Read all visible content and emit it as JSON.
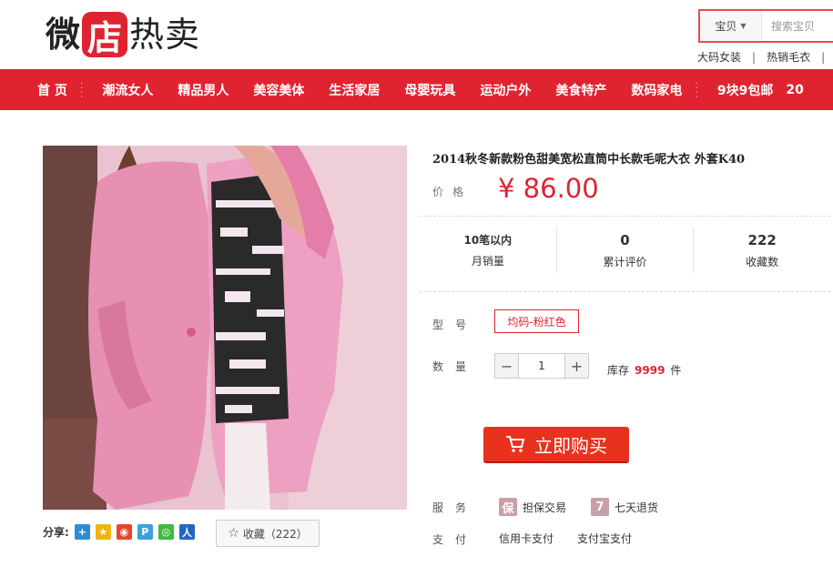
{
  "logo": {
    "char1": "微",
    "char2": "店",
    "rest": "热卖"
  },
  "search": {
    "type_label": "宝贝",
    "placeholder": "搜索宝贝"
  },
  "hot_links": [
    "大码女装",
    "热销毛衣"
  ],
  "nav": {
    "home": "首 页",
    "items": [
      "潮流女人",
      "精品男人",
      "美容美体",
      "生活家居",
      "母婴玩具",
      "运动户外",
      "美食特产",
      "数码家电",
      "9块9包邮",
      "20"
    ]
  },
  "product": {
    "title": "2014秋冬新款粉色甜美宽松直筒中长款毛呢大衣 外套K40",
    "price_label": "价格",
    "price": "¥ 86.00",
    "stats": [
      {
        "value": "10笔以内",
        "label": "月销量"
      },
      {
        "value": "0",
        "label": "累计评价"
      },
      {
        "value": "222",
        "label": "收藏数"
      }
    ],
    "model_label": "型号",
    "model_option": "均码-粉红色",
    "qty_label": "数量",
    "qty_value": "1",
    "stock_prefix": "库存",
    "stock_num": "9999",
    "stock_unit": "件",
    "buy_label": "立即购买",
    "service_label": "服务",
    "services": [
      {
        "icon": "保",
        "text": "担保交易"
      },
      {
        "icon": "7",
        "text": "七天退货"
      }
    ],
    "payment_label": "支付",
    "payments": [
      "信用卡支付",
      "支付宝支付"
    ]
  },
  "share": {
    "label": "分享:",
    "fav_label": "收藏（222）"
  },
  "colors": {
    "brand_red": "#e02330",
    "buy_red": "#e8321e"
  }
}
